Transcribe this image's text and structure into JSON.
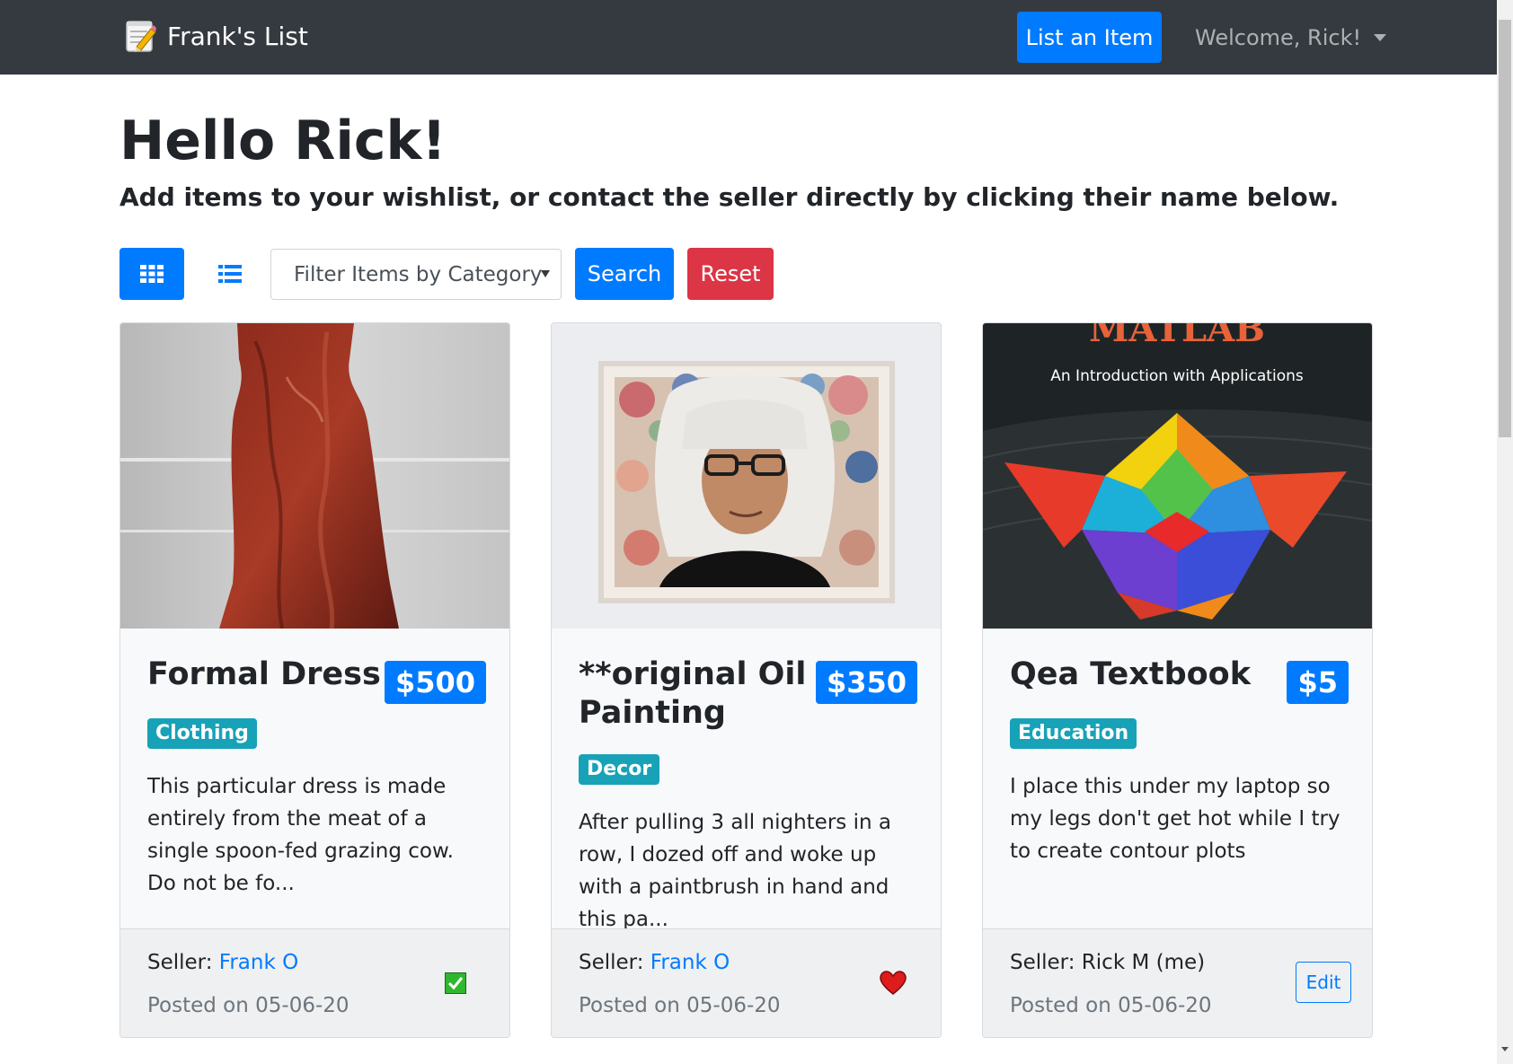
{
  "navbar": {
    "brand": "Frank's List",
    "list_item_label": "List an Item",
    "welcome_label": "Welcome, Rick!"
  },
  "header": {
    "title": "Hello Rick!",
    "subtitle": "Add items to your wishlist, or contact the seller directly by clicking their name below."
  },
  "toolbar": {
    "filter_placeholder": "Filter Items by Category",
    "search_label": "Search",
    "reset_label": "Reset"
  },
  "items": [
    {
      "title": "Formal Dress",
      "price": "$500",
      "category": "Clothing",
      "description": "This particular dress is made entirely from the meat of a single spoon-fed grazing cow. Do not be fo...",
      "seller_prefix": "Seller: ",
      "seller": "Frank O",
      "posted": "Posted on 05-06-20",
      "action_icon": "checkbox-checked-icon"
    },
    {
      "title": "**original Oil Painting",
      "price": "$350",
      "category": "Decor",
      "description": "After pulling 3 all nighters in a row, I dozed off and woke up with a paintbrush in hand and this pa...",
      "seller_prefix": "Seller: ",
      "seller": "Frank O",
      "posted": "Posted on 05-06-20",
      "action_icon": "heart-icon"
    },
    {
      "title": "Qea Textbook",
      "price": "$5",
      "category": "Education",
      "description": "I place this under my laptop so my legs don't get hot while I try to create contour plots",
      "seller_prefix": "Seller: ",
      "seller": "Rick M (me)",
      "posted": "Posted on 05-06-20",
      "edit_label": "Edit"
    }
  ],
  "textbook_cover": {
    "title_fragment": "MATLAB",
    "subtitle": "An Introduction with Applications"
  },
  "colors": {
    "primary": "#007bff",
    "danger": "#dc3545",
    "info": "#17a2b8",
    "navbar": "#343a40"
  }
}
